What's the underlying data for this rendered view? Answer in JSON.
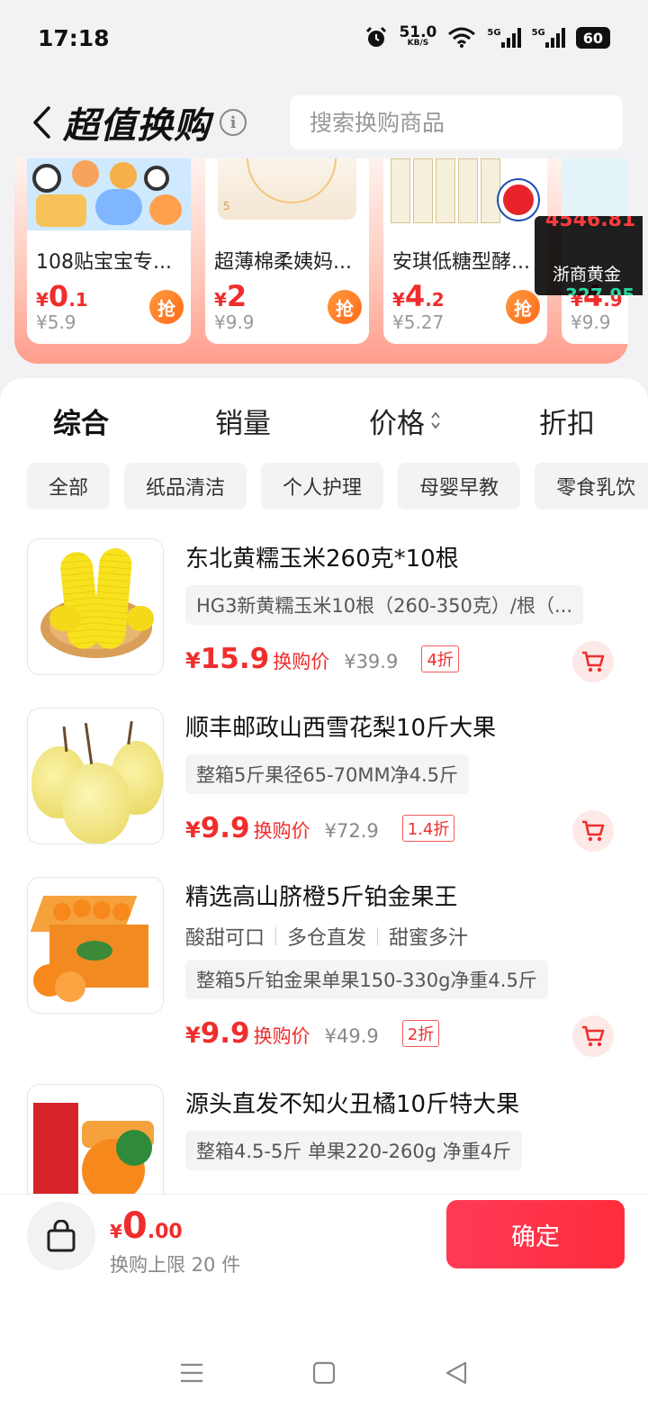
{
  "status_bar": {
    "time": "17:18",
    "net_speed": "51.0",
    "net_unit": "KB/S",
    "sig1": "5G",
    "sig2": "5G",
    "battery": "60"
  },
  "header": {
    "title": "超值换购",
    "search_placeholder": "搜索换购商品"
  },
  "promo": {
    "items": [
      {
        "name": "108贴宝宝专...",
        "price_int": "0",
        "price_dec": ".1",
        "orig": "¥5.9",
        "grab": "抢"
      },
      {
        "name": "超薄棉柔姨妈...",
        "price_int": "2",
        "price_dec": "",
        "orig": "¥9.9",
        "grab": "抢"
      },
      {
        "name": "安琪低糖型酵...",
        "price_int": "4",
        "price_dec": ".2",
        "orig": "¥5.27",
        "grab": "抢"
      },
      {
        "name": "",
        "price_int": "4",
        "price_dec": ".9",
        "orig": "¥9.9",
        "grab": ""
      }
    ],
    "currency": "¥"
  },
  "ticker": {
    "top_value": "4546.81",
    "name": "浙商黄金",
    "bottom_value": "327.95"
  },
  "sort_tabs": [
    "综合",
    "销量",
    "价格",
    "折扣"
  ],
  "categories": [
    "全部",
    "纸品清洁",
    "个人护理",
    "母婴早教",
    "零食乳饮"
  ],
  "products": [
    {
      "title": "东北黄糯玉米260克*10根",
      "tags": [],
      "spec": "HG3新黄糯玉米10根（260-350克）/根（...",
      "price": "15.9",
      "price_label": "换购价",
      "orig": "¥39.9",
      "discount": "4折",
      "currency": "¥"
    },
    {
      "title": "顺丰邮政山西雪花梨10斤大果",
      "tags": [],
      "spec": "整箱5斤果径65-70MM净4.5斤",
      "price": "9.9",
      "price_label": "换购价",
      "orig": "¥72.9",
      "discount": "1.4折",
      "currency": "¥"
    },
    {
      "title": "精选高山脐橙5斤铂金果王",
      "tags": [
        "酸甜可口",
        "多仓直发",
        "甜蜜多汁"
      ],
      "spec": "整箱5斤铂金果单果150-330g净重4.5斤",
      "price": "9.9",
      "price_label": "换购价",
      "orig": "¥49.9",
      "discount": "2折",
      "currency": "¥"
    },
    {
      "title": "源头直发不知火丑橘10斤特大果",
      "tags": [],
      "spec": "整箱4.5-5斤 单果220-260g 净重4斤",
      "price": "",
      "price_label": "",
      "orig": "",
      "discount": "",
      "currency": ""
    }
  ],
  "bottom": {
    "currency": "¥",
    "total_int": "0",
    "total_dec": ".00",
    "limit_text": "换购上限 20 件",
    "confirm": "确定"
  },
  "colors": {
    "accent": "#f02d2d",
    "confirm": "#ff2d45",
    "grab": "#ff7a22"
  }
}
